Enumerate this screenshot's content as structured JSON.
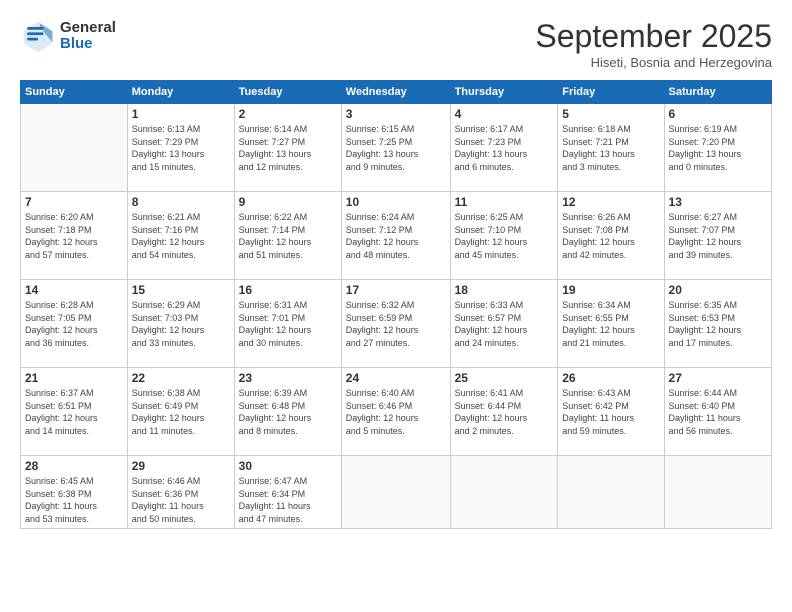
{
  "logo": {
    "general": "General",
    "blue": "Blue"
  },
  "title": "September 2025",
  "subtitle": "Hiseti, Bosnia and Herzegovina",
  "weekdays": [
    "Sunday",
    "Monday",
    "Tuesday",
    "Wednesday",
    "Thursday",
    "Friday",
    "Saturday"
  ],
  "weeks": [
    [
      {
        "day": "",
        "info": ""
      },
      {
        "day": "1",
        "info": "Sunrise: 6:13 AM\nSunset: 7:29 PM\nDaylight: 13 hours\nand 15 minutes."
      },
      {
        "day": "2",
        "info": "Sunrise: 6:14 AM\nSunset: 7:27 PM\nDaylight: 13 hours\nand 12 minutes."
      },
      {
        "day": "3",
        "info": "Sunrise: 6:15 AM\nSunset: 7:25 PM\nDaylight: 13 hours\nand 9 minutes."
      },
      {
        "day": "4",
        "info": "Sunrise: 6:17 AM\nSunset: 7:23 PM\nDaylight: 13 hours\nand 6 minutes."
      },
      {
        "day": "5",
        "info": "Sunrise: 6:18 AM\nSunset: 7:21 PM\nDaylight: 13 hours\nand 3 minutes."
      },
      {
        "day": "6",
        "info": "Sunrise: 6:19 AM\nSunset: 7:20 PM\nDaylight: 13 hours\nand 0 minutes."
      }
    ],
    [
      {
        "day": "7",
        "info": "Sunrise: 6:20 AM\nSunset: 7:18 PM\nDaylight: 12 hours\nand 57 minutes."
      },
      {
        "day": "8",
        "info": "Sunrise: 6:21 AM\nSunset: 7:16 PM\nDaylight: 12 hours\nand 54 minutes."
      },
      {
        "day": "9",
        "info": "Sunrise: 6:22 AM\nSunset: 7:14 PM\nDaylight: 12 hours\nand 51 minutes."
      },
      {
        "day": "10",
        "info": "Sunrise: 6:24 AM\nSunset: 7:12 PM\nDaylight: 12 hours\nand 48 minutes."
      },
      {
        "day": "11",
        "info": "Sunrise: 6:25 AM\nSunset: 7:10 PM\nDaylight: 12 hours\nand 45 minutes."
      },
      {
        "day": "12",
        "info": "Sunrise: 6:26 AM\nSunset: 7:08 PM\nDaylight: 12 hours\nand 42 minutes."
      },
      {
        "day": "13",
        "info": "Sunrise: 6:27 AM\nSunset: 7:07 PM\nDaylight: 12 hours\nand 39 minutes."
      }
    ],
    [
      {
        "day": "14",
        "info": "Sunrise: 6:28 AM\nSunset: 7:05 PM\nDaylight: 12 hours\nand 36 minutes."
      },
      {
        "day": "15",
        "info": "Sunrise: 6:29 AM\nSunset: 7:03 PM\nDaylight: 12 hours\nand 33 minutes."
      },
      {
        "day": "16",
        "info": "Sunrise: 6:31 AM\nSunset: 7:01 PM\nDaylight: 12 hours\nand 30 minutes."
      },
      {
        "day": "17",
        "info": "Sunrise: 6:32 AM\nSunset: 6:59 PM\nDaylight: 12 hours\nand 27 minutes."
      },
      {
        "day": "18",
        "info": "Sunrise: 6:33 AM\nSunset: 6:57 PM\nDaylight: 12 hours\nand 24 minutes."
      },
      {
        "day": "19",
        "info": "Sunrise: 6:34 AM\nSunset: 6:55 PM\nDaylight: 12 hours\nand 21 minutes."
      },
      {
        "day": "20",
        "info": "Sunrise: 6:35 AM\nSunset: 6:53 PM\nDaylight: 12 hours\nand 17 minutes."
      }
    ],
    [
      {
        "day": "21",
        "info": "Sunrise: 6:37 AM\nSunset: 6:51 PM\nDaylight: 12 hours\nand 14 minutes."
      },
      {
        "day": "22",
        "info": "Sunrise: 6:38 AM\nSunset: 6:49 PM\nDaylight: 12 hours\nand 11 minutes."
      },
      {
        "day": "23",
        "info": "Sunrise: 6:39 AM\nSunset: 6:48 PM\nDaylight: 12 hours\nand 8 minutes."
      },
      {
        "day": "24",
        "info": "Sunrise: 6:40 AM\nSunset: 6:46 PM\nDaylight: 12 hours\nand 5 minutes."
      },
      {
        "day": "25",
        "info": "Sunrise: 6:41 AM\nSunset: 6:44 PM\nDaylight: 12 hours\nand 2 minutes."
      },
      {
        "day": "26",
        "info": "Sunrise: 6:43 AM\nSunset: 6:42 PM\nDaylight: 11 hours\nand 59 minutes."
      },
      {
        "day": "27",
        "info": "Sunrise: 6:44 AM\nSunset: 6:40 PM\nDaylight: 11 hours\nand 56 minutes."
      }
    ],
    [
      {
        "day": "28",
        "info": "Sunrise: 6:45 AM\nSunset: 6:38 PM\nDaylight: 11 hours\nand 53 minutes."
      },
      {
        "day": "29",
        "info": "Sunrise: 6:46 AM\nSunset: 6:36 PM\nDaylight: 11 hours\nand 50 minutes."
      },
      {
        "day": "30",
        "info": "Sunrise: 6:47 AM\nSunset: 6:34 PM\nDaylight: 11 hours\nand 47 minutes."
      },
      {
        "day": "",
        "info": ""
      },
      {
        "day": "",
        "info": ""
      },
      {
        "day": "",
        "info": ""
      },
      {
        "day": "",
        "info": ""
      }
    ]
  ]
}
